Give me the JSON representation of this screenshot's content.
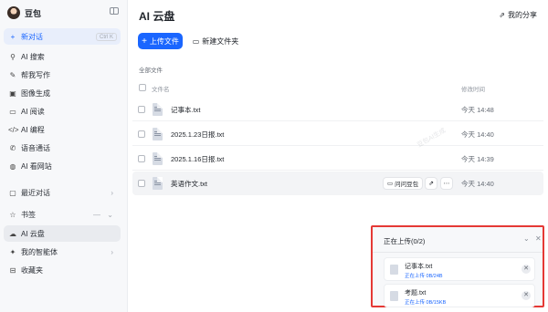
{
  "sidebar": {
    "brand_name": "豆包",
    "new_chat": {
      "label": "新对话",
      "shortcut": "Ctrl K"
    },
    "items": [
      {
        "label": "AI 搜索",
        "icon": "search-icon"
      },
      {
        "label": "帮我写作",
        "icon": "pen-icon"
      },
      {
        "label": "图像生成",
        "icon": "image-icon"
      },
      {
        "label": "AI 阅读",
        "icon": "book-icon"
      },
      {
        "label": "AI 编程",
        "icon": "code-icon"
      },
      {
        "label": "语音通话",
        "icon": "phone-icon"
      },
      {
        "label": "AI 看网站",
        "icon": "globe-icon"
      }
    ],
    "recent_chats": "最近对话",
    "bookmarks": "书签",
    "ai_cloud": "AI 云盘",
    "my_agents": "我的智能体",
    "favorites": "收藏夹"
  },
  "main": {
    "title": "AI 云盘",
    "share_label": "我的分享",
    "upload_button": "上传文件",
    "new_folder_button": "新建文件夹",
    "section_label": "全部文件",
    "columns": {
      "name": "文件名",
      "modified": "修改时间"
    },
    "files": [
      {
        "name": "记事本.txt",
        "time": "今天 14:48"
      },
      {
        "name": "2025.1.23日报.txt",
        "time": "今天 14:40"
      },
      {
        "name": "2025.1.16日报.txt",
        "time": "今天 14:39"
      },
      {
        "name": "英语作文.txt",
        "time": "今天 14:40"
      }
    ],
    "row_actions": {
      "ask_label": "问问豆包"
    },
    "watermark": "豆包AI生成"
  },
  "upload_panel": {
    "title": "正在上传(0/2)",
    "items": [
      {
        "name": "记事本.txt",
        "status": "正在上传 0B/24B",
        "progress": 0
      },
      {
        "name": "考题.txt",
        "status": "正在上传 0B/15KB",
        "progress": 0
      }
    ]
  },
  "colors": {
    "accent": "#1a66ff",
    "highlight_border": "#e53935"
  }
}
